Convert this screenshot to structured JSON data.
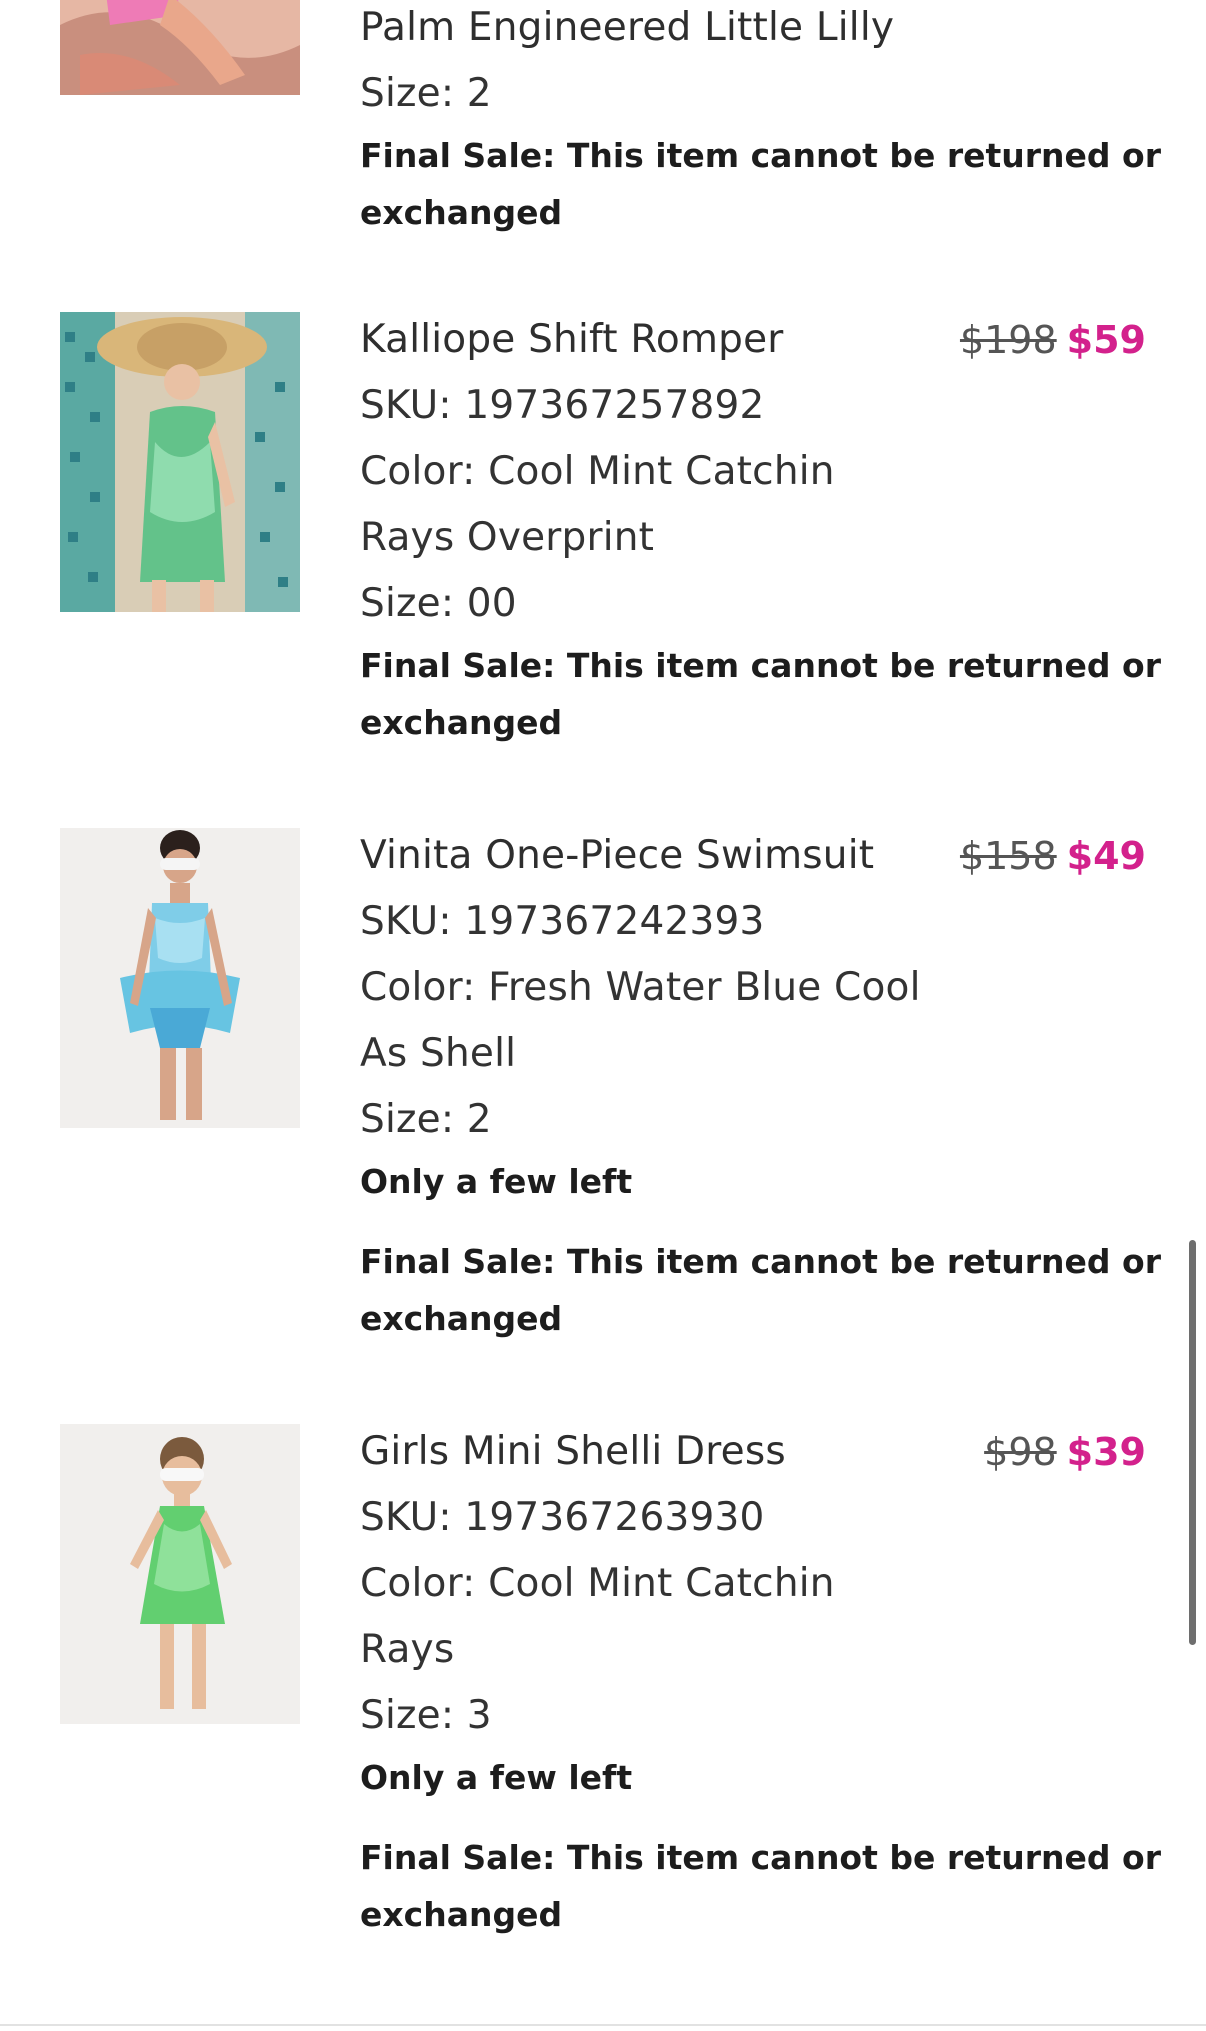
{
  "colors": {
    "sale_price": "#d3218c",
    "text": "#333333"
  },
  "items": [
    {
      "color_line2": "Palm Engineered Little Lilly",
      "size": "Size: 2",
      "final_sale_1": "Final Sale: This item cannot be returned or",
      "final_sale_2": "exchanged"
    },
    {
      "name": "Kalliope Shift Romper",
      "sku": "SKU: 197367257892",
      "color_line1": "Color: Cool Mint Catchin",
      "color_line2": "Rays Overprint",
      "size": "Size: 00",
      "final_sale_1": "Final Sale: This item cannot be returned or",
      "final_sale_2": "exchanged",
      "price_original": "$198",
      "price_sale": "$59"
    },
    {
      "name": "Vinita One-Piece Swimsuit",
      "sku": "SKU: 197367242393",
      "color_line1": "Color: Fresh Water Blue Cool",
      "color_line2": "As Shell",
      "size": "Size: 2",
      "stock": "Only a few left",
      "final_sale_1": "Final Sale: This item cannot be returned or",
      "final_sale_2": "exchanged",
      "price_original": "$158",
      "price_sale": "$49"
    },
    {
      "name": "Girls Mini Shelli Dress",
      "sku": "SKU: 197367263930",
      "color_line1": "Color: Cool Mint Catchin",
      "color_line2": "Rays",
      "size": "Size: 3",
      "stock": "Only a few left",
      "final_sale_1": "Final Sale: This item cannot be returned or",
      "final_sale_2": "exchanged",
      "price_original": "$98",
      "price_sale": "$39"
    }
  ]
}
